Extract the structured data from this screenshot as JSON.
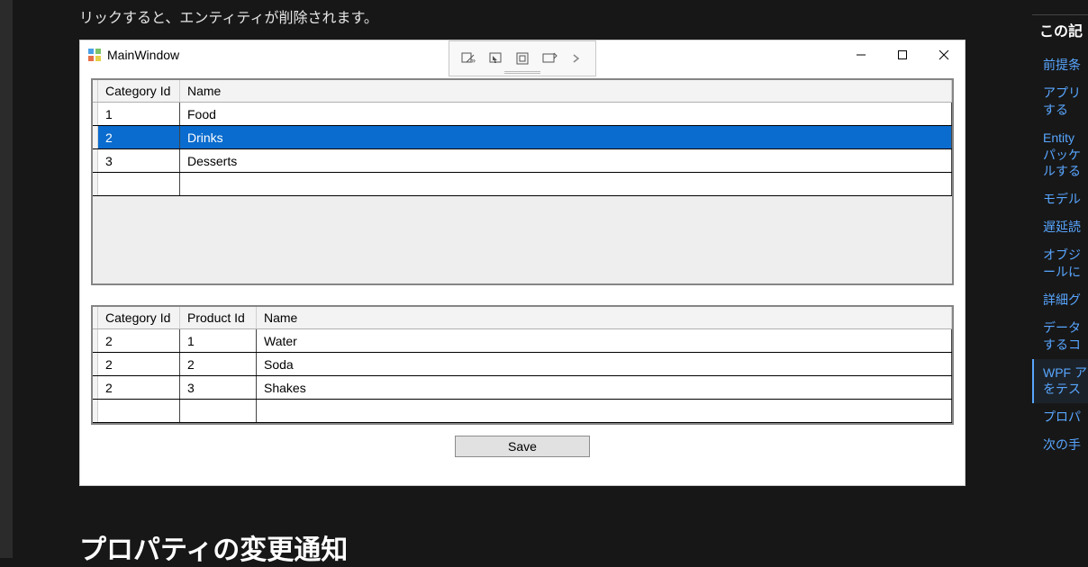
{
  "body_text": "リックすると、エンティティが削除されます。",
  "section_heading": "プロパティの変更通知",
  "window": {
    "title": "MainWindow",
    "save_button": "Save"
  },
  "grid1": {
    "headers": {
      "category_id": "Category Id",
      "name": "Name"
    },
    "rows": [
      {
        "category_id": "1",
        "name": "Food",
        "selected": false
      },
      {
        "category_id": "2",
        "name": "Drinks",
        "selected": true
      },
      {
        "category_id": "3",
        "name": "Desserts",
        "selected": false
      }
    ]
  },
  "grid2": {
    "headers": {
      "category_id": "Category Id",
      "product_id": "Product Id",
      "name": "Name"
    },
    "rows": [
      {
        "category_id": "2",
        "product_id": "1",
        "name": "Water"
      },
      {
        "category_id": "2",
        "product_id": "2",
        "name": "Soda"
      },
      {
        "category_id": "2",
        "product_id": "3",
        "name": "Shakes"
      }
    ]
  },
  "right_nav": {
    "title": "この記",
    "items": [
      {
        "label": "前提条"
      },
      {
        "label": "アプリ\nする"
      },
      {
        "label": "Entity \nパッケ\nルする"
      },
      {
        "label": "モデル"
      },
      {
        "label": "遅延読"
      },
      {
        "label": "オブジ\nールに"
      },
      {
        "label": "詳細グ"
      },
      {
        "label": "データ\nするコ"
      },
      {
        "label": "WPF ア\nをテス",
        "active": true
      },
      {
        "label": "プロパ"
      },
      {
        "label": "次の手"
      }
    ]
  }
}
